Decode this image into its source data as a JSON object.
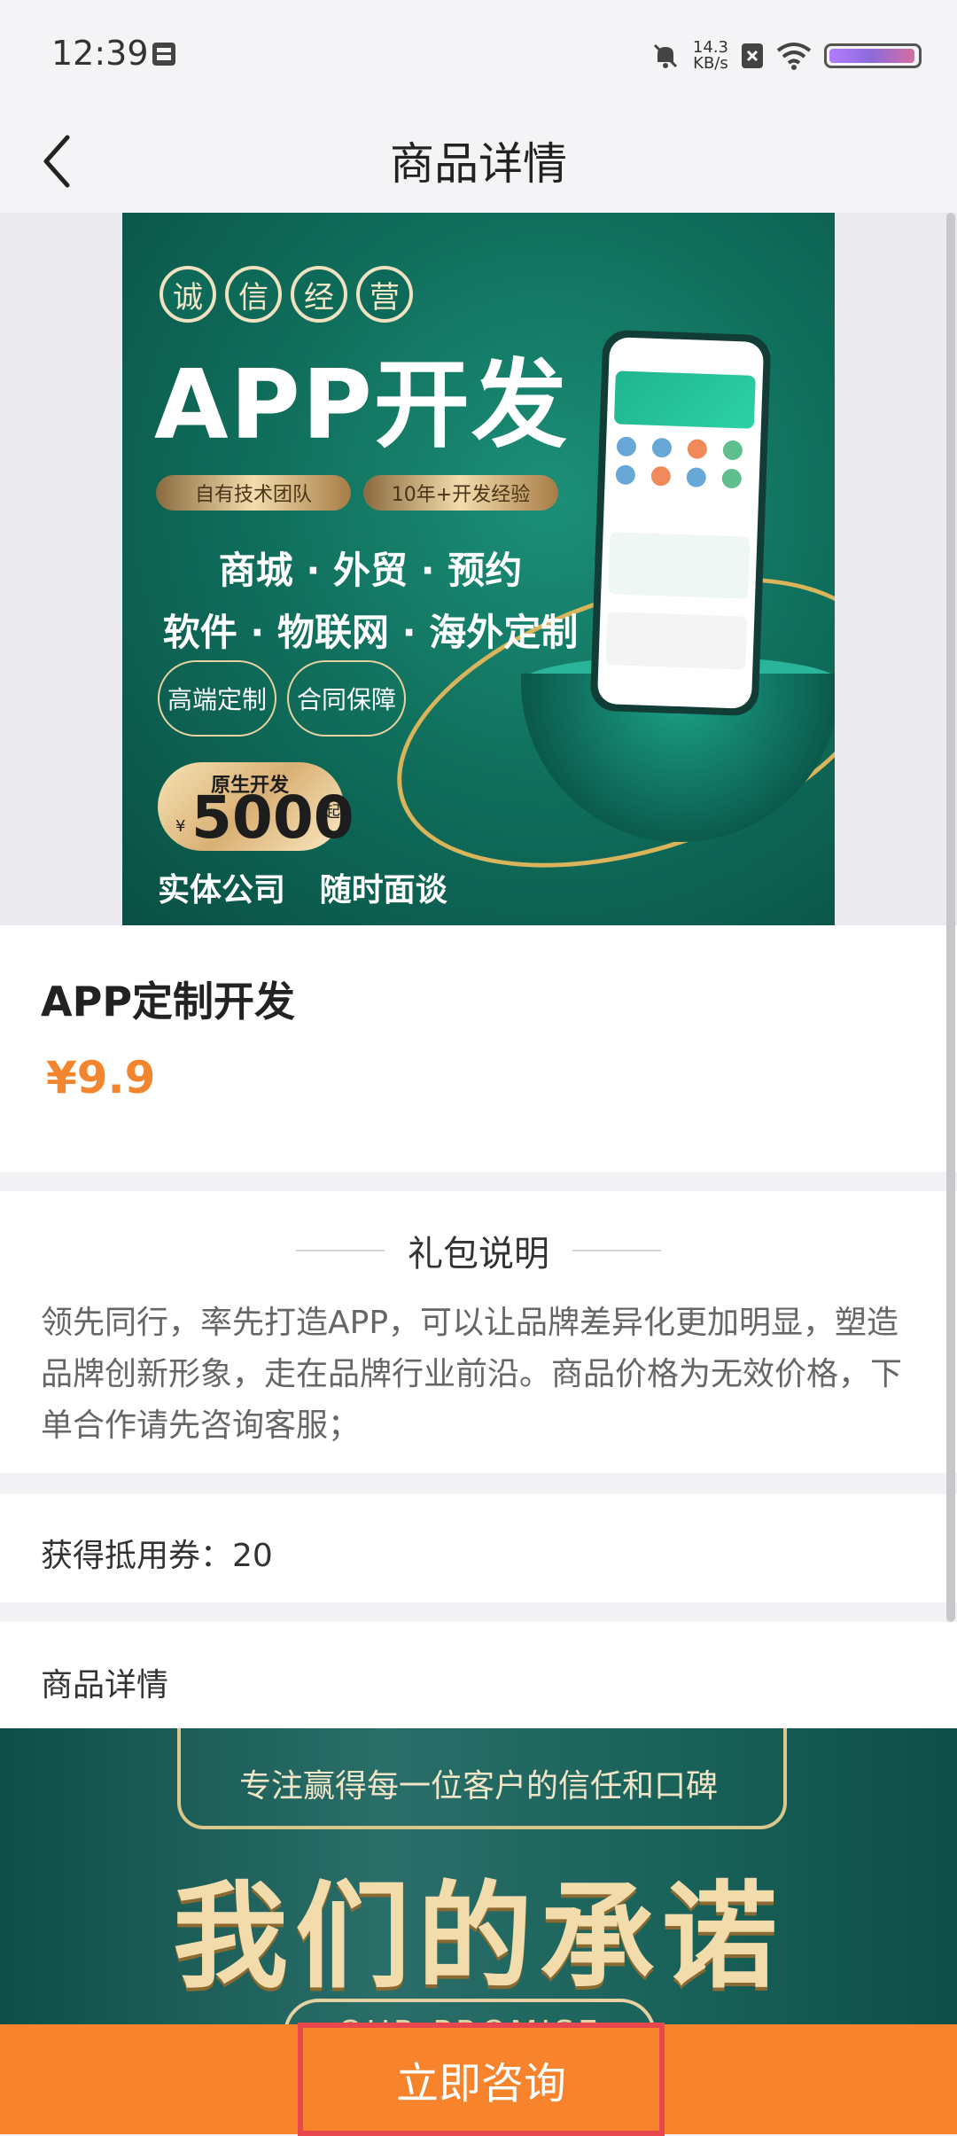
{
  "status_bar": {
    "time": "12:39",
    "net_speed_value": "14.3",
    "net_speed_unit": "KB/s"
  },
  "nav": {
    "title": "商品详情"
  },
  "hero_banner": {
    "seals": [
      "诚",
      "信",
      "经",
      "营"
    ],
    "title": "APP开发",
    "pill_left": "自有技术团队",
    "pill_right": "10年+开发经验",
    "line1": "商城 · 外贸 · 预约",
    "line2": "软件 · 物联网 · 海外定制",
    "badge1": "高端定制",
    "badge2": "合同保障",
    "price_label": "原生开发",
    "price_yen": "¥",
    "price_value": "5000",
    "price_suffix": "起",
    "bottom_left": "实体公司",
    "bottom_right": "随时面谈"
  },
  "product": {
    "name": "APP定制开发",
    "price": "¥9.9"
  },
  "gift": {
    "title": "礼包说明",
    "description": "领先同行，率先打造APP，可以让品牌差异化更加明显，塑造品牌创新形象，走在品牌行业前沿。商品价格为无效价格，下单合作请先咨询客服；"
  },
  "coupon": {
    "label": "获得抵用券：20"
  },
  "detail": {
    "label": "商品详情",
    "image_sub": "专注赢得每一位客户的信任和口碑",
    "image_main": "我们的承诺",
    "image_en": "OUR PROMISE"
  },
  "bottom": {
    "consult_label": "立即咨询",
    "accent_color": "#f7842d"
  }
}
